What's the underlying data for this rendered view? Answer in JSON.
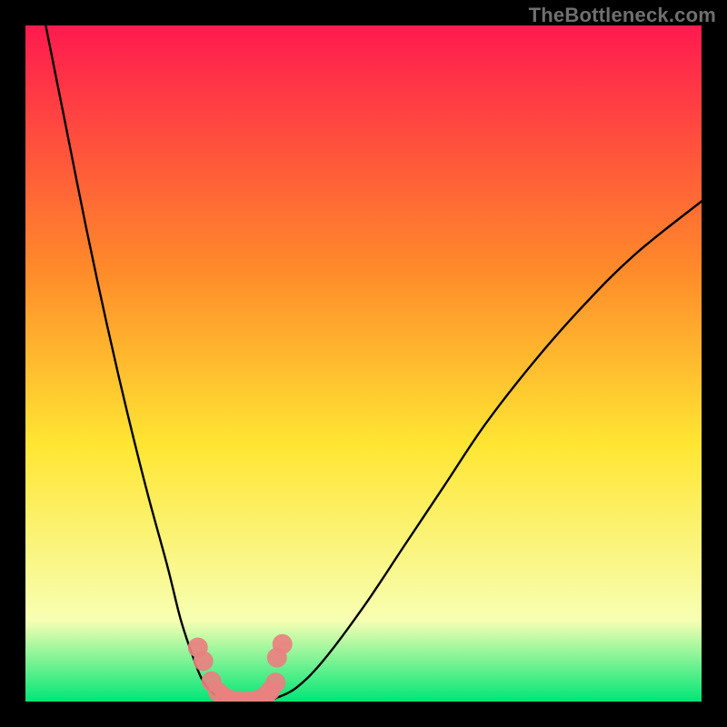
{
  "watermark": "TheBottleneck.com",
  "chart_data": {
    "type": "line",
    "title": "",
    "xlabel": "",
    "ylabel": "",
    "xlim": [
      0,
      100
    ],
    "ylim": [
      0,
      100
    ],
    "background_gradient": {
      "top": "#ff1a4f",
      "mid_upper": "#ff8a2a",
      "mid": "#ffe633",
      "mid_lower": "#f7ffb3",
      "bottom": "#00e676"
    },
    "series": [
      {
        "name": "left-branch",
        "x": [
          3,
          6,
          9,
          12,
          15,
          18,
          21,
          23,
          25,
          26,
          27,
          28,
          29
        ],
        "y": [
          100,
          85,
          70,
          56,
          43,
          31,
          20,
          12,
          6,
          3.5,
          2,
          1,
          0.3
        ]
      },
      {
        "name": "valley",
        "x": [
          29,
          30,
          31,
          32,
          33,
          34,
          35,
          36,
          37
        ],
        "y": [
          0.3,
          0.1,
          0.0,
          0.0,
          0.0,
          0.0,
          0.1,
          0.2,
          0.5
        ]
      },
      {
        "name": "right-branch",
        "x": [
          37,
          40,
          44,
          50,
          56,
          62,
          68,
          75,
          82,
          90,
          100
        ],
        "y": [
          0.5,
          2,
          6,
          14,
          23,
          32,
          41,
          50,
          58,
          66,
          74
        ]
      }
    ],
    "markers": {
      "name": "highlight-dots",
      "color": "#e98080",
      "points": [
        {
          "x": 25.5,
          "y": 8.0
        },
        {
          "x": 26.3,
          "y": 6.0
        },
        {
          "x": 27.5,
          "y": 3.0
        },
        {
          "x": 28.5,
          "y": 1.4
        },
        {
          "x": 29.5,
          "y": 0.6
        },
        {
          "x": 30.5,
          "y": 0.2
        },
        {
          "x": 31.8,
          "y": 0.1
        },
        {
          "x": 33.2,
          "y": 0.1
        },
        {
          "x": 34.5,
          "y": 0.3
        },
        {
          "x": 35.5,
          "y": 0.8
        },
        {
          "x": 36.2,
          "y": 1.6
        },
        {
          "x": 37.0,
          "y": 2.8
        },
        {
          "x": 37.2,
          "y": 6.5
        },
        {
          "x": 38.0,
          "y": 8.5
        }
      ]
    }
  }
}
